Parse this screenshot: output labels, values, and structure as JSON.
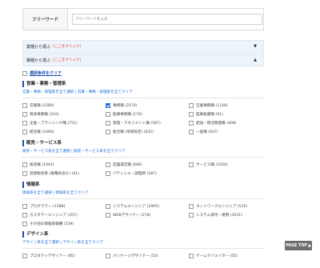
{
  "search": {
    "label": "フリーワード",
    "placeholder": "フリーワードを入力"
  },
  "accordion": [
    {
      "label": "業種から選ぶ",
      "note": "(ここをクリック)",
      "arrow": "▼"
    },
    {
      "label": "職種から選ぶ",
      "note": "(ここをクリック)",
      "arrow": "▲"
    }
  ],
  "clear_all": "選択条件をクリア",
  "categories": [
    {
      "title": "営業・事務・管理系",
      "links": "営業・事務・管理系を全て選択 | 営業・事務・管理系を全てクリア",
      "items": [
        {
          "label": "営業職 (5289)",
          "checked": false
        },
        {
          "label": "事務職 (2574)",
          "checked": true
        },
        {
          "label": "営業事務職 (1148)",
          "checked": false
        },
        {
          "label": "貿易事務職 (210)",
          "checked": false
        },
        {
          "label": "医療事務職 (170)",
          "checked": false
        },
        {
          "label": "医療秘書職 (91)",
          "checked": false
        },
        {
          "label": "企画・プランニング職 (751)",
          "checked": false
        },
        {
          "label": "管理・マネジメント職 (587)",
          "checked": false
        },
        {
          "label": "配送・物流関連職 (408)",
          "checked": false
        },
        {
          "label": "総合職 (3360)",
          "checked": false
        },
        {
          "label": "総合職 (地域限定) (832)",
          "checked": false
        },
        {
          "label": "一般職 (647)",
          "checked": false
        }
      ]
    },
    {
      "title": "販売・サービス系",
      "links": "販売・サービス系を全て選択 | 販売・サービス系を全てクリア",
      "items": [
        {
          "label": "販売職 (1043)",
          "checked": false
        },
        {
          "label": "店舗運営職 (686)",
          "checked": false
        },
        {
          "label": "サービス職 (1050)",
          "checked": false
        },
        {
          "label": "登録販売者 (薬種商含む) (41)",
          "checked": false
        },
        {
          "label": "パティシエ・調理師 (187)",
          "checked": false
        }
      ]
    },
    {
      "title": "情報系",
      "links": "情報系を全て選択 | 情報系を全てクリア",
      "items": [
        {
          "label": "プログラマー (1388)",
          "checked": false
        },
        {
          "label": "システムエンジニア (2065)",
          "checked": false
        },
        {
          "label": "ネットワークエンジニア (515)",
          "checked": false
        },
        {
          "label": "カスタマーエンジニア (357)",
          "checked": false
        },
        {
          "label": "WEBデザイナー (278)",
          "checked": false
        },
        {
          "label": "システム保守・運用 (1031)",
          "checked": false
        },
        {
          "label": "その他の情報系職種 (539)",
          "checked": false
        }
      ]
    },
    {
      "title": "デザイン系",
      "links": "デザイン系を全て選択 | デザイン系を全てクリア",
      "items": [
        {
          "label": "プロダクトデザイナー (85)",
          "checked": false
        },
        {
          "label": "パッケージデザイナー (53)",
          "checked": false
        },
        {
          "label": "ゲームクリエイター (55)",
          "checked": false
        }
      ]
    }
  ],
  "page_top": "PAGE TOP"
}
